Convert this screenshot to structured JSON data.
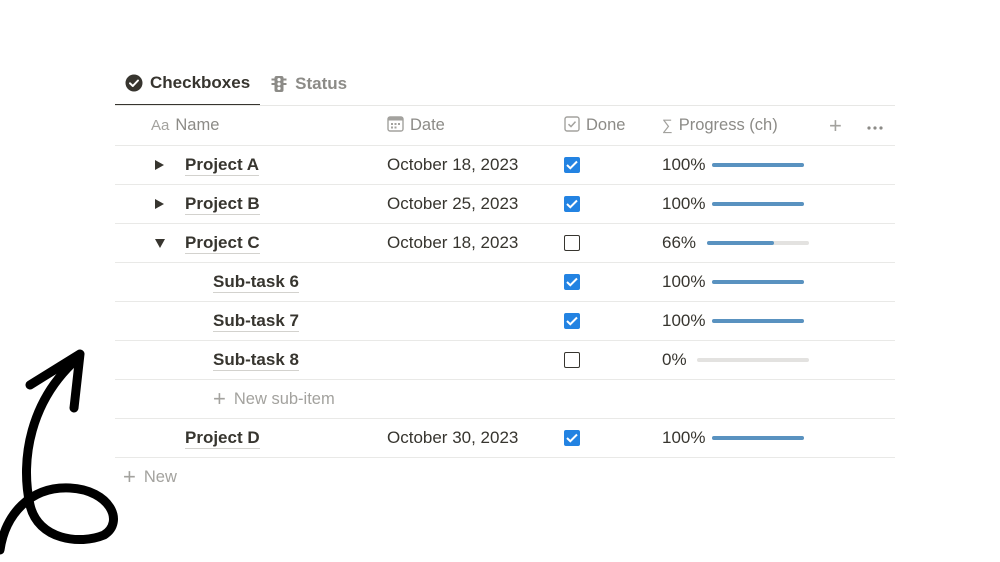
{
  "tabs": [
    {
      "label": "Checkboxes",
      "icon": "check-circle-icon",
      "active": true
    },
    {
      "label": "Status",
      "icon": "traffic-light-icon",
      "active": false
    }
  ],
  "columns": {
    "name": {
      "label": "Name",
      "icon_text": "Aa"
    },
    "date": {
      "label": "Date",
      "icon": "calendar-icon"
    },
    "done": {
      "label": "Done",
      "icon": "checkbox-icon"
    },
    "progress": {
      "label": "Progress (ch)",
      "icon_text": "∑"
    }
  },
  "rows": [
    {
      "name": "Project A",
      "date": "October 18, 2023",
      "done": true,
      "progress_label": "100%",
      "progress": 1.0,
      "toggle": "collapsed",
      "level": 0
    },
    {
      "name": "Project B",
      "date": "October 25, 2023",
      "done": true,
      "progress_label": "100%",
      "progress": 1.0,
      "toggle": "collapsed",
      "level": 0
    },
    {
      "name": "Project C",
      "date": "October 18, 2023",
      "done": false,
      "progress_label": "66%",
      "progress": 0.66,
      "toggle": "expanded",
      "level": 0
    },
    {
      "name": "Sub-task 6",
      "date": "",
      "done": true,
      "progress_label": "100%",
      "progress": 1.0,
      "toggle": "none",
      "level": 1
    },
    {
      "name": "Sub-task 7",
      "date": "",
      "done": true,
      "progress_label": "100%",
      "progress": 1.0,
      "toggle": "none",
      "level": 1
    },
    {
      "name": "Sub-task 8",
      "date": "",
      "done": false,
      "progress_label": "0%",
      "progress": 0.0,
      "toggle": "none",
      "level": 1
    }
  ],
  "new_sub_item_label": "New sub-item",
  "last_row": {
    "name": "Project D",
    "date": "October 30, 2023",
    "done": true,
    "progress_label": "100%",
    "progress": 1.0
  },
  "new_label": "New",
  "colors": {
    "accent": "#2383e2",
    "progress": "#5992c0",
    "track": "#e3e2e0",
    "text": "#37352f",
    "muted": "#8c8b87"
  }
}
